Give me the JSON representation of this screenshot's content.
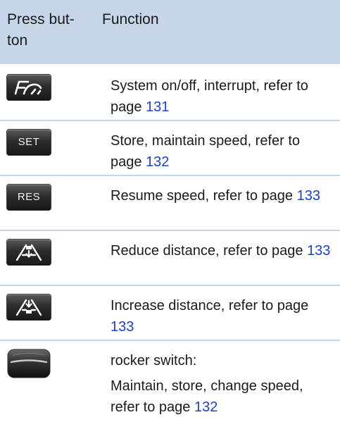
{
  "header": {
    "col1_line1": "Press but-",
    "col1_line2": "ton",
    "col2": "Function"
  },
  "rows": [
    {
      "icon": "cruise-control-icon",
      "text": "System on/off, interrupt, refer to page ",
      "page": "131"
    },
    {
      "button_label": "SET",
      "text": "Store, maintain speed, refer to page ",
      "page": "132"
    },
    {
      "button_label": "RES",
      "text": "Resume speed, refer to page ",
      "page": "133"
    },
    {
      "icon": "reduce-distance-icon",
      "text": "Reduce distance, refer to page ",
      "page": "133"
    },
    {
      "icon": "increase-distance-icon",
      "text": "Increase distance, refer to page ",
      "page": "133"
    },
    {
      "icon": "rocker-switch-icon",
      "title": "rocker switch:",
      "text": "Maintain, store, change speed, refer to page ",
      "page": "132"
    }
  ],
  "colors": {
    "header_bg": "#c6d6e8",
    "link": "#1a3fd6",
    "button_dark": "#1a1a1a"
  }
}
